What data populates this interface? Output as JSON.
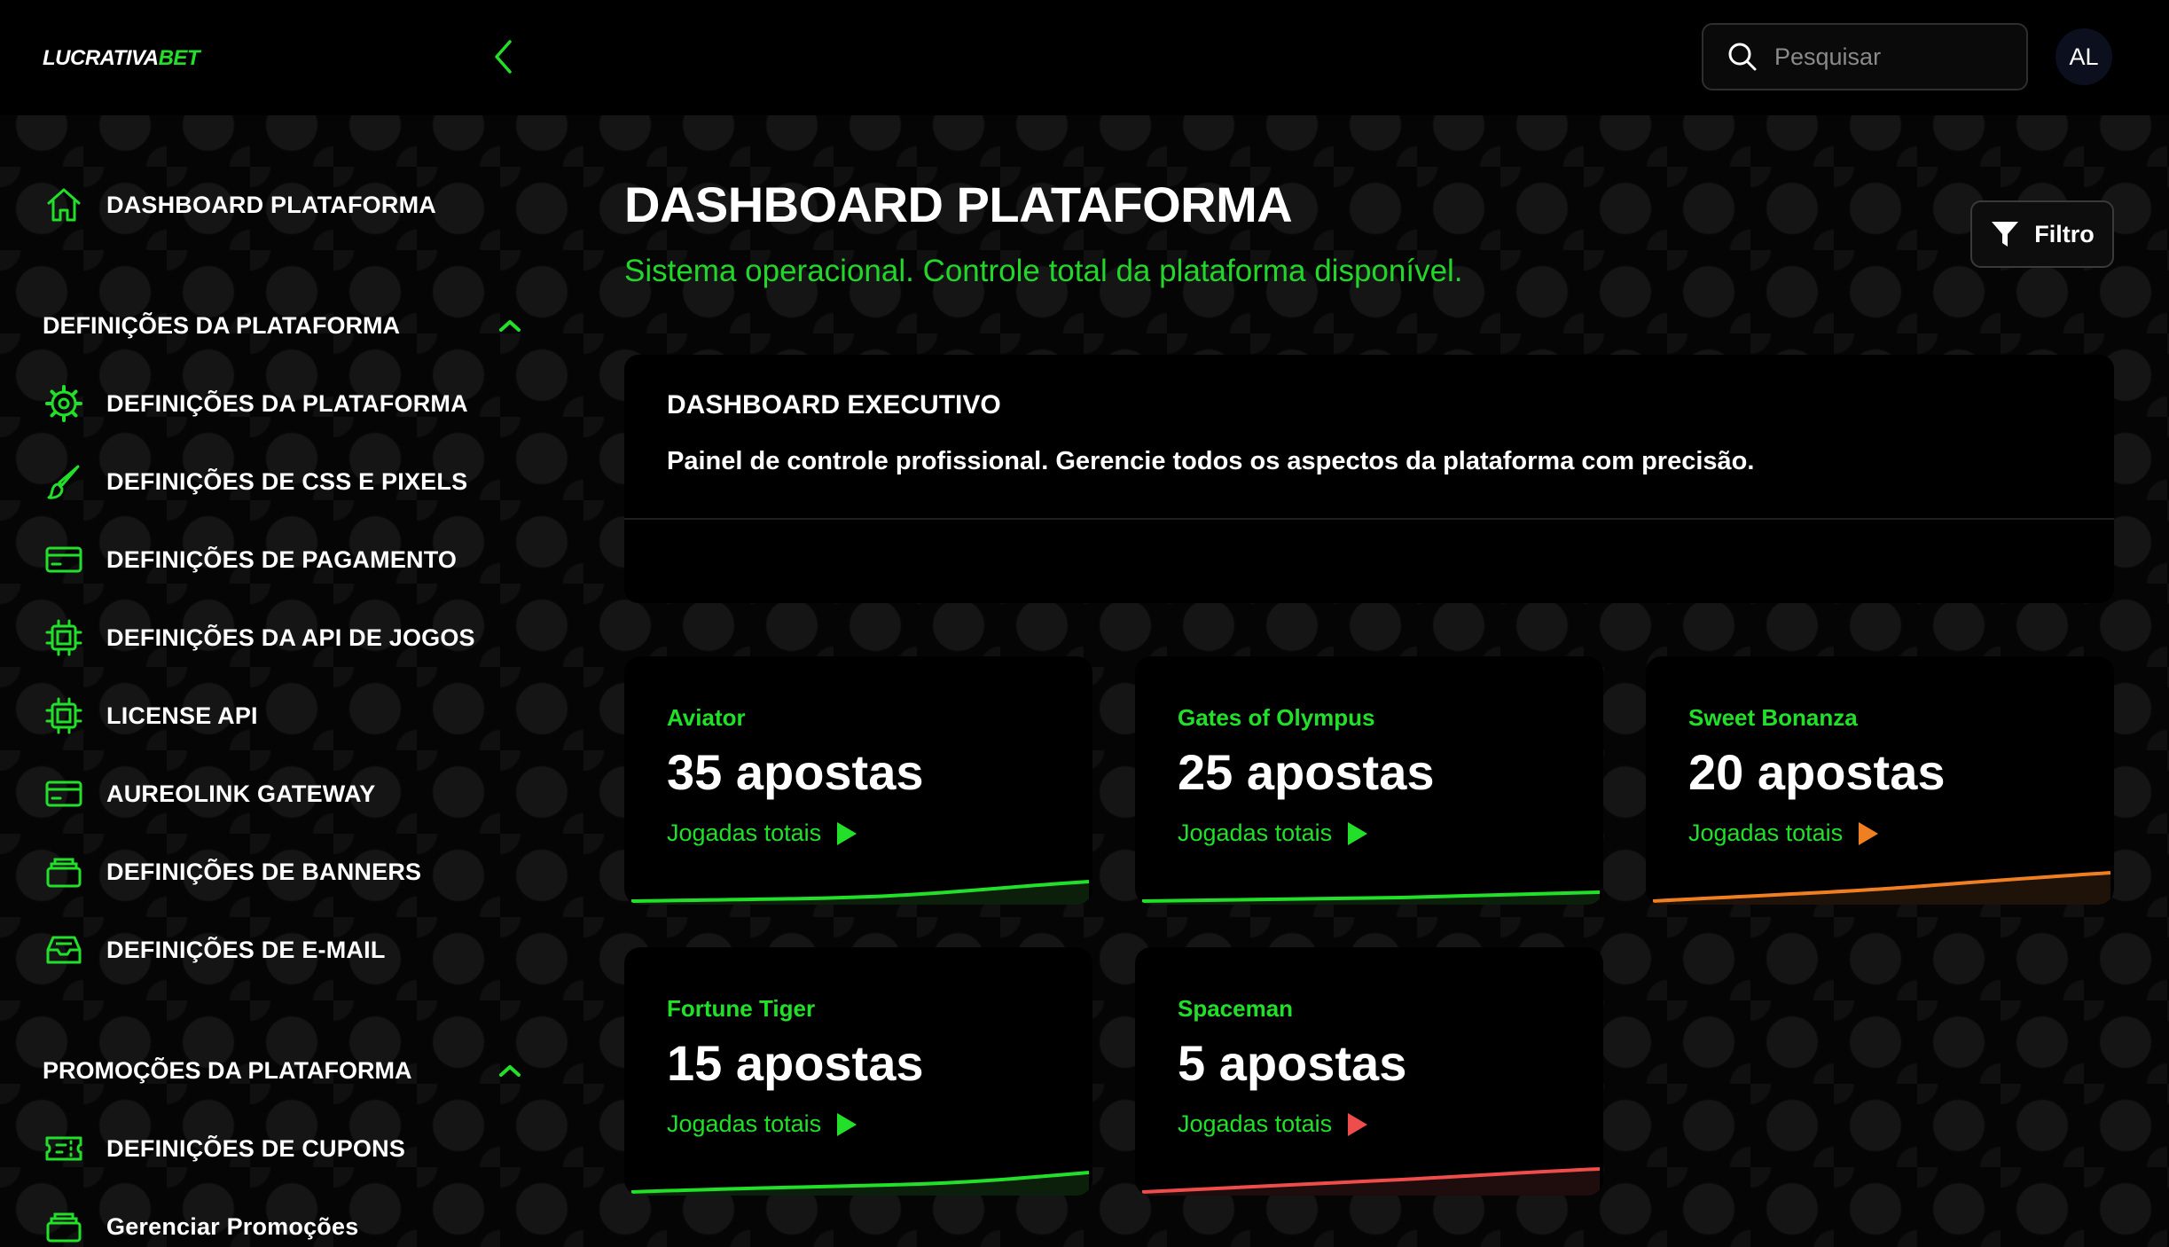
{
  "header": {
    "logo_text": "LUCRATIVA",
    "logo_accent": "BET",
    "search_placeholder": "Pesquisar",
    "avatar_initials": "AL"
  },
  "sidebar": {
    "top_item": {
      "label": "DASHBOARD PLATAFORMA",
      "icon": "home-icon"
    },
    "sections": [
      {
        "title": "DEFINIÇÕES DA PLATAFORMA",
        "expanded": true,
        "items": [
          {
            "label": "DEFINIÇÕES DA PLATAFORMA",
            "icon": "gear-icon"
          },
          {
            "label": "DEFINIÇÕES DE CSS E PIXELS",
            "icon": "brush-icon"
          },
          {
            "label": "DEFINIÇÕES DE PAGAMENTO",
            "icon": "credit-card-icon"
          },
          {
            "label": "DEFINIÇÕES DA API DE JOGOS",
            "icon": "chip-icon"
          },
          {
            "label": "LICENSE API",
            "icon": "chip-icon"
          },
          {
            "label": "AUREOLINK GATEWAY",
            "icon": "credit-card-icon"
          },
          {
            "label": "DEFINIÇÕES DE BANNERS",
            "icon": "stack-icon"
          },
          {
            "label": "DEFINIÇÕES DE E-MAIL",
            "icon": "inbox-icon"
          }
        ]
      },
      {
        "title": "PROMOÇÕES DA PLATAFORMA",
        "expanded": true,
        "items": [
          {
            "label": "DEFINIÇÕES DE CUPONS",
            "icon": "ticket-icon"
          },
          {
            "label": "Gerenciar Promoções",
            "icon": "stack-icon"
          }
        ]
      }
    ]
  },
  "main": {
    "title": "DASHBOARD PLATAFORMA",
    "subtitle": "Sistema operacional. Controle total da plataforma disponível.",
    "filter_label": "Filtro",
    "exec_card": {
      "title": "DASHBOARD EXECUTIVO",
      "description": "Painel de controle profissional. Gerencie todos os aspectos da plataforma com precisão."
    },
    "games": [
      {
        "name": "Aviator",
        "count": "35 apostas",
        "sub": "Jogadas totais",
        "trend_color": "#22e02a",
        "fill_color": "#0b1f0b"
      },
      {
        "name": "Gates of Olympus",
        "count": "25 apostas",
        "sub": "Jogadas totais",
        "trend_color": "#22e02a",
        "fill_color": "#0b1f0b"
      },
      {
        "name": "Sweet Bonanza",
        "count": "20 apostas",
        "sub": "Jogadas totais",
        "trend_color": "#f07f22",
        "fill_color": "#1f1208"
      },
      {
        "name": "Fortune Tiger",
        "count": "15 apostas",
        "sub": "Jogadas totais",
        "trend_color": "#22e02a",
        "fill_color": "#0b1f0b"
      },
      {
        "name": "Spaceman",
        "count": "5 apostas",
        "sub": "Jogadas totais",
        "trend_color": "#ef4c4c",
        "fill_color": "#1f0c0c"
      }
    ]
  },
  "colors": {
    "accent": "#22e02a",
    "background": "#050505",
    "card": "#000000"
  }
}
